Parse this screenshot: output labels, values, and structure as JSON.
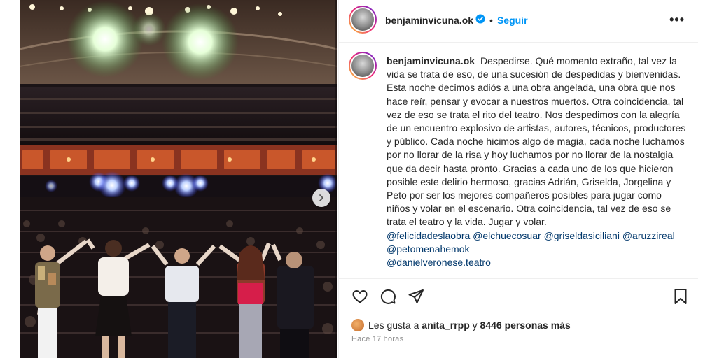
{
  "post": {
    "username": "benjaminvicuna.ok",
    "separator": "•",
    "follow_label": "Seguir",
    "more_label": "•••",
    "caption_text": "Despedirse. Qué momento extraño, tal vez la vida se trata de eso, de una sucesión de despedidas y bienvenidas. Esta noche decimos adiós a una obra angelada, una obra que nos hace reír, pensar y evocar a nuestros muertos. Otra coincidencia, tal vez de eso se trata el rito del teatro. Nos despedimos con la alegría de un encuentro explosivo de artistas, autores, técnicos, productores y público. Cada noche hicimos algo de magia, cada noche luchamos por no llorar de la risa y hoy luchamos por no llorar de la nostalgia que da decir hasta pronto. Gracias a cada uno de los que hicieron posible este delirio hermoso, gracias Adrián, Griselda, Jorgelina y Peto por ser los mejores compañeros posibles para jugar como niños y volar en el escenario. Otra coincidencia, tal vez de eso se trata el teatro y la vida. Jugar y volar.",
    "mentions": [
      "@felicidadeslaobra",
      "@elchuecosuar",
      "@griseldasiciliani",
      "@aruzzireal",
      "@petomenahemok",
      "@danielveronese.teatro"
    ],
    "likes_prefix": "Les gusta a",
    "likes_user": "anita_rrpp",
    "likes_connector": "y",
    "likes_count": "8446 personas más",
    "timestamp": "Hace 17 horas"
  },
  "icons": {
    "verified": "verified-badge-icon",
    "like": "heart-icon",
    "comment": "comment-icon",
    "share": "paper-plane-icon",
    "save": "bookmark-icon",
    "next": "chevron-right-icon"
  },
  "colors": {
    "link": "#0095f6",
    "mention": "#00376b",
    "muted": "#8e8e8e",
    "text": "#262626"
  }
}
